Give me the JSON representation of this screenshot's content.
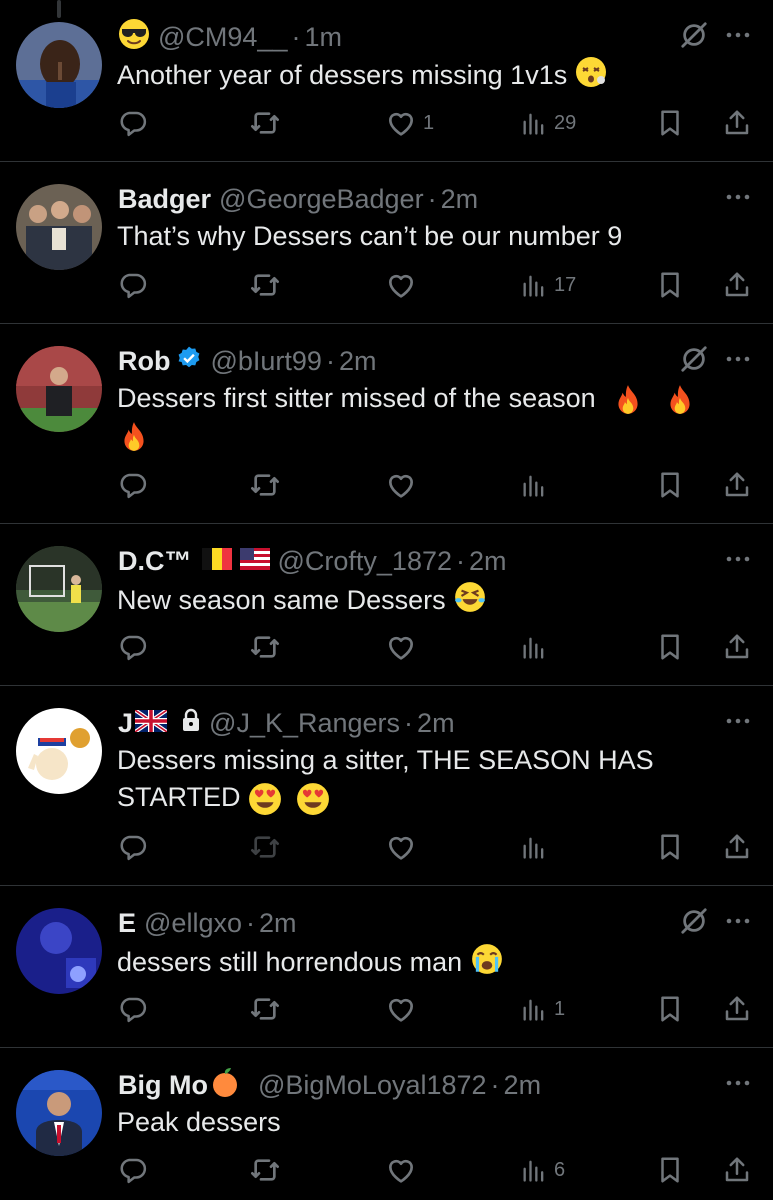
{
  "tweets": [
    {
      "name": "",
      "handle": "@CM94__",
      "time": "1m",
      "text": "Another year of dessers missing 1v1s",
      "likes": "1",
      "views": "29",
      "grok": true,
      "name_emoji": "sunglasses-emoji",
      "end_emoji": "dizzy-face-emoji"
    },
    {
      "name": "Badger",
      "handle": "@GeorgeBadger",
      "time": "2m",
      "text": "That’s why Dessers can’t be our number 9",
      "likes": "",
      "views": "17",
      "grok": false
    },
    {
      "name": "Rob",
      "handle": "@bIurt99",
      "time": "2m",
      "text": "Dessers first sitter missed of the season",
      "likes": "",
      "views": "",
      "grok": true,
      "verified": true,
      "end_emoji": "fire-emoji x3"
    },
    {
      "name": "D.C™",
      "handle": "@Crofty_1872",
      "time": "2m",
      "text": "New season same Dessers",
      "likes": "",
      "views": "",
      "grok": false,
      "name_emoji": "belgium-flag, usa-flag",
      "end_emoji": "rofl-emoji"
    },
    {
      "name": "J",
      "handle": "@J_K_Rangers",
      "time": "2m",
      "text_line1": "Dessers missing a sitter, THE SEASON HAS",
      "text_line2": "STARTED",
      "likes": "",
      "views": "",
      "grok": false,
      "name_emoji": "uk-flag",
      "locked": true,
      "end_emoji": "heart-eyes-emoji x2"
    },
    {
      "name": "E",
      "handle": "@ellgxo",
      "time": "2m",
      "text": "dessers still horrendous man",
      "likes": "",
      "views": "1",
      "grok": true,
      "end_emoji": "crying-emoji"
    },
    {
      "name": "Big Mo",
      "handle": "@BigMoLoyal1872",
      "time": "2m",
      "text": "Peak dessers",
      "likes": "",
      "views": "6",
      "grok": false,
      "name_emoji": "peach-emoji"
    }
  ],
  "separator": "·",
  "colors": {
    "background": "#000000",
    "text": "#e7e9ea",
    "muted": "#71767b",
    "divider": "#2f3336",
    "verified": "#1d9bf0"
  },
  "icons": [
    "reply-icon",
    "retweet-icon",
    "like-icon",
    "views-icon",
    "bookmark-icon",
    "share-icon",
    "grok-icon",
    "more-icon"
  ]
}
